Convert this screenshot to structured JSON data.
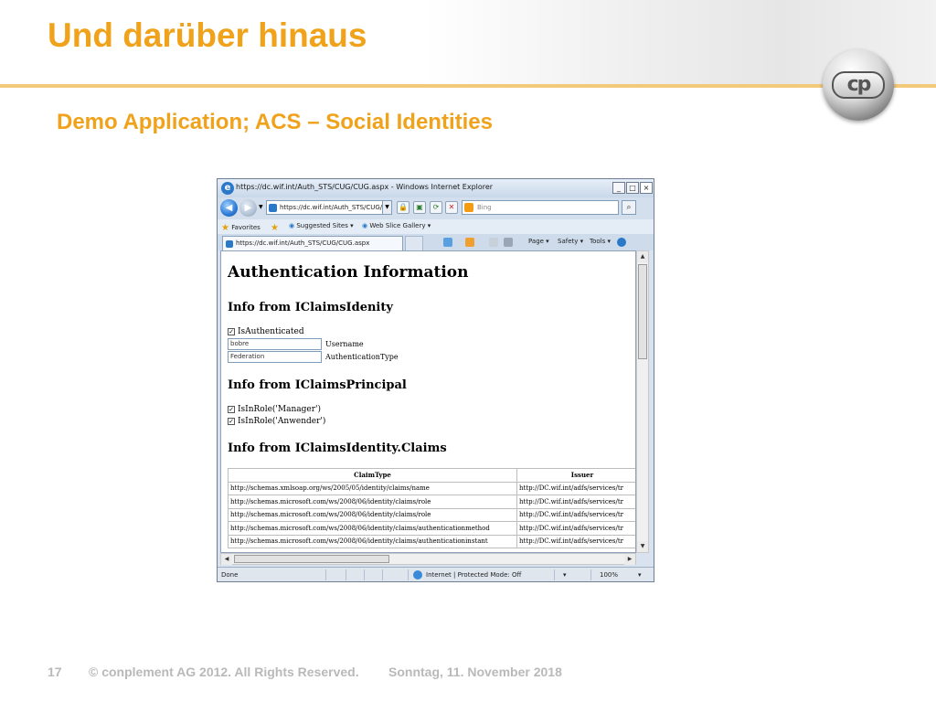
{
  "slide": {
    "title": "Und darüber hinaus",
    "subtitle": "Demo Application; ACS – Social Identities",
    "logo_text": "cp",
    "footer": {
      "page_number": "17",
      "copyright": "© conplement AG 2012. All Rights Reserved.",
      "date": "Sonntag, 11. November 2018"
    }
  },
  "browser": {
    "window_title": "https://dc.wif.int/Auth_STS/CUG/CUG.aspx - Windows Internet Explorer",
    "window_buttons": [
      "_",
      "□",
      "×"
    ],
    "address": "https://dc.wif.int/Auth_STS/CUG/",
    "search_placeholder": "Bing",
    "favorites": {
      "favorites_label": "Favorites",
      "items": [
        "Suggested Sites ▾",
        "Web Slice Gallery ▾"
      ]
    },
    "tab_title": "https://dc.wif.int/Auth_STS/CUG/CUG.aspx",
    "command_bar": [
      "Page ▾",
      "Safety ▾",
      "Tools ▾"
    ],
    "status": {
      "left": "Done",
      "zone": "Internet | Protected Mode: Off",
      "zoom": "100%"
    }
  },
  "page": {
    "heading": "Authentication Information",
    "section1": "Info from IClaimsIdenity",
    "is_authenticated_label": "IsAuthenticated",
    "is_authenticated": true,
    "username_value": "bobre",
    "username_label": "Username",
    "authtype_value": "Federation",
    "authtype_label": "AuthenticationType",
    "section2": "Info from IClaimsPrincipal",
    "roles": [
      {
        "label": "IsInRole('Manager')",
        "checked": true
      },
      {
        "label": "IsInRole('Anwender')",
        "checked": true
      }
    ],
    "section3": "Info from IClaimsIdentity.Claims",
    "claims_table": {
      "columns": [
        "ClaimType",
        "Issuer"
      ],
      "rows": [
        [
          "http://schemas.xmlsoap.org/ws/2005/05/identity/claims/name",
          "http://DC.wif.int/adfs/services/tr"
        ],
        [
          "http://schemas.microsoft.com/ws/2008/06/identity/claims/role",
          "http://DC.wif.int/adfs/services/tr"
        ],
        [
          "http://schemas.microsoft.com/ws/2008/06/identity/claims/role",
          "http://DC.wif.int/adfs/services/tr"
        ],
        [
          "http://schemas.microsoft.com/ws/2008/06/identity/claims/authenticationmethod",
          "http://DC.wif.int/adfs/services/tr"
        ],
        [
          "http://schemas.microsoft.com/ws/2008/06/identity/claims/authenticationinstant",
          "http://DC.wif.int/adfs/services/tr"
        ]
      ]
    }
  },
  "colors": {
    "accent_orange": "#f0a21b",
    "footer_gray": "#b9b9b9"
  }
}
